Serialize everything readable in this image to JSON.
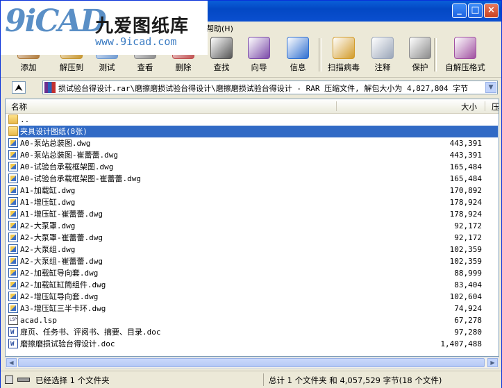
{
  "window": {
    "logo_mark": "9iCAD",
    "logo_cn": "九爱图纸库",
    "logo_url": "www.9icad.com",
    "min_label": "_",
    "max_label": "□",
    "close_label": "×"
  },
  "menu": {
    "help": "帮助(H)"
  },
  "toolbar": [
    {
      "name": "add",
      "label": "添加",
      "color": "#b07a3a"
    },
    {
      "name": "extract",
      "label": "解压到",
      "color": "#c7962f"
    },
    {
      "name": "test",
      "label": "测试",
      "color": "#6f9ad1"
    },
    {
      "name": "view",
      "label": "查看",
      "color": "#8c8c8c"
    },
    {
      "name": "delete",
      "label": "删除",
      "color": "#c05050"
    },
    {
      "name": "find",
      "label": "查找",
      "color": "#555555"
    },
    {
      "name": "wizard",
      "label": "向导",
      "color": "#7b4aa8"
    },
    {
      "name": "info",
      "label": "信息",
      "color": "#2f6fd0"
    },
    {
      "name": "scan",
      "label": "扫描病毒",
      "color": "#d29b2a"
    },
    {
      "name": "comment",
      "label": "注释",
      "color": "#9aa5b8"
    },
    {
      "name": "protect",
      "label": "保护",
      "color": "#8a8a8a"
    },
    {
      "name": "sfx",
      "label": "自解压格式",
      "color": "#a04fa0"
    }
  ],
  "address": {
    "up_label": "⮝",
    "path": "损试验台得设计.rar\\磨擦磨损试验台得设计\\磨擦磨损试验台得设计 - RAR 压缩文件, 解包大小为 4,827,804 字节"
  },
  "columns": {
    "name": "名称",
    "size": "大小",
    "packed": "压"
  },
  "files": [
    {
      "type": "folder",
      "name": "..",
      "size": ""
    },
    {
      "type": "folder",
      "name": "夹具设计图纸(8张)",
      "size": "",
      "selected": true
    },
    {
      "type": "dwg",
      "name": "A0-泵站总装图.dwg",
      "size": "443,391"
    },
    {
      "type": "dwg",
      "name": "A0-泵站总装图-崔蕾蕾.dwg",
      "size": "443,391"
    },
    {
      "type": "dwg",
      "name": "A0-试验台承载框架图.dwg",
      "size": "165,484"
    },
    {
      "type": "dwg",
      "name": "A0-试验台承载框架图-崔蕾蕾.dwg",
      "size": "165,484"
    },
    {
      "type": "dwg",
      "name": "A1-加载缸.dwg",
      "size": "170,892"
    },
    {
      "type": "dwg",
      "name": "A1-增压缸.dwg",
      "size": "178,924"
    },
    {
      "type": "dwg",
      "name": "A1-增压缸-崔蕾蕾.dwg",
      "size": "178,924"
    },
    {
      "type": "dwg",
      "name": "A2-大泵罩.dwg",
      "size": "92,172"
    },
    {
      "type": "dwg",
      "name": "A2-大泵罩-崔蕾蕾.dwg",
      "size": "92,172"
    },
    {
      "type": "dwg",
      "name": "A2-大泵组.dwg",
      "size": "102,359"
    },
    {
      "type": "dwg",
      "name": "A2-大泵组-崔蕾蕾.dwg",
      "size": "102,359"
    },
    {
      "type": "dwg",
      "name": "A2-加载缸导向套.dwg",
      "size": "88,999"
    },
    {
      "type": "dwg",
      "name": "A2-加载缸缸筒组件.dwg",
      "size": "83,404"
    },
    {
      "type": "dwg",
      "name": "A2-增压缸导向套.dwg",
      "size": "102,604"
    },
    {
      "type": "dwg",
      "name": "A3-增压缸三半卡环.dwg",
      "size": "74,924"
    },
    {
      "type": "lsp",
      "name": "acad.lsp",
      "size": "67,278"
    },
    {
      "type": "doc",
      "name": "扉页、任务书、评阅书、摘要、目录.doc",
      "size": "97,280"
    },
    {
      "type": "doc",
      "name": "磨擦磨损试验台得设计.doc",
      "size": "1,407,488"
    }
  ],
  "status": {
    "left": "已经选择 1 个文件夹",
    "right": "总计 1 个文件夹 和 4,057,529 字节(18 个文件)"
  }
}
